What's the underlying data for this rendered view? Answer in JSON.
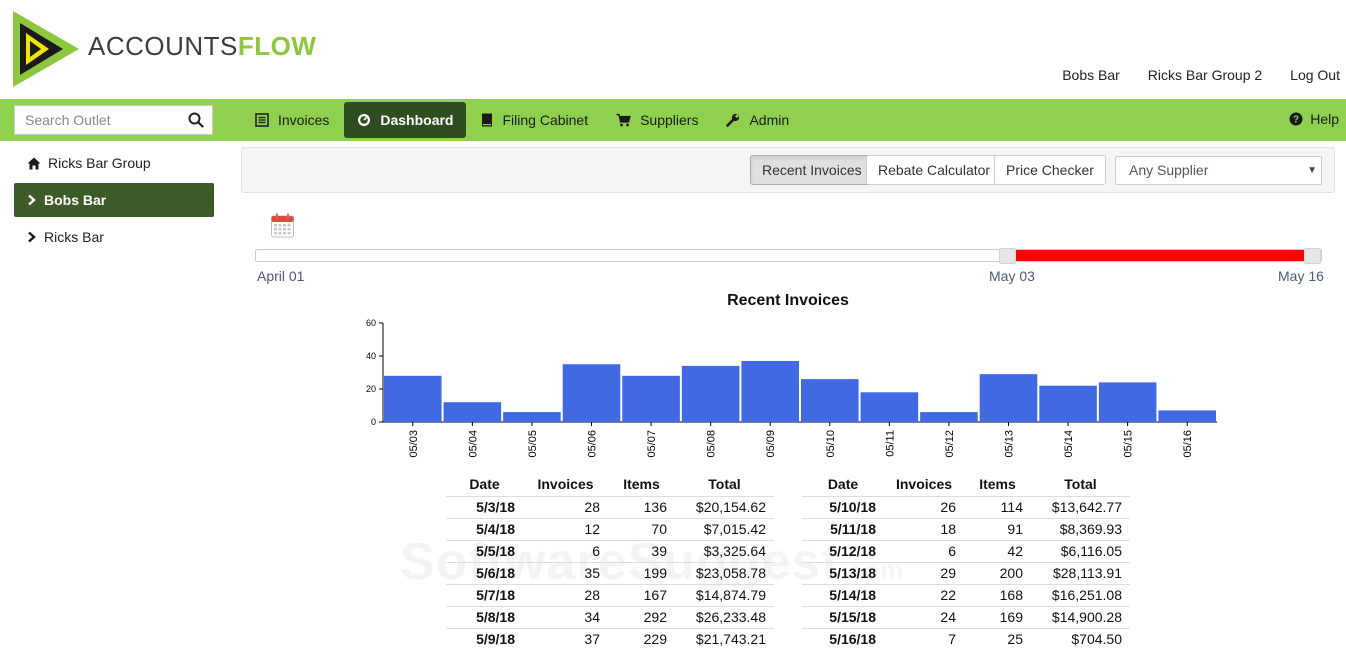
{
  "brand": {
    "name_part1": "ACCOUNTS",
    "name_part2": "FLOW",
    "logo_icon": "play-triangle-logo"
  },
  "top_links": [
    "Bobs Bar",
    "Ricks Bar Group 2",
    "Log Out"
  ],
  "search": {
    "placeholder": "Search Outlet",
    "value": ""
  },
  "nav": [
    {
      "label": "Invoices",
      "icon": "list-icon",
      "active": false
    },
    {
      "label": "Dashboard",
      "icon": "dashboard-icon",
      "active": true
    },
    {
      "label": "Filing Cabinet",
      "icon": "book-icon",
      "active": false
    },
    {
      "label": "Suppliers",
      "icon": "cart-icon",
      "active": false
    },
    {
      "label": "Admin",
      "icon": "wrench-icon",
      "active": false
    }
  ],
  "help": {
    "label": "Help",
    "icon": "question-circle-icon"
  },
  "sidebar": [
    {
      "label": "Ricks Bar Group",
      "icon": "home-icon",
      "active": false
    },
    {
      "label": "Bobs Bar",
      "icon": "chevron-right-icon",
      "active": true
    },
    {
      "label": "Ricks Bar",
      "icon": "chevron-right-icon",
      "active": false
    }
  ],
  "toolbar": {
    "buttons": [
      "Recent Invoices",
      "Rebate Calculator",
      "Price Checker"
    ],
    "active_button": "Recent Invoices",
    "supplier_select": "Any Supplier"
  },
  "slider": {
    "start_label": "April 01",
    "range_start_label": "May 03",
    "end_label": "May 16",
    "range_start_fraction": 0.705,
    "range_end_fraction": 1.0,
    "range_color": "#ff0000"
  },
  "chart_data": {
    "type": "bar",
    "title": "Recent Invoices",
    "categories": [
      "05/03",
      "05/04",
      "05/05",
      "05/06",
      "05/07",
      "05/08",
      "05/09",
      "05/10",
      "05/11",
      "05/12",
      "05/13",
      "05/14",
      "05/15",
      "05/16"
    ],
    "values": [
      28,
      12,
      6,
      35,
      28,
      34,
      37,
      26,
      18,
      6,
      29,
      22,
      24,
      7
    ],
    "yticks": [
      0,
      20,
      40,
      60
    ],
    "ylim": [
      0,
      60
    ],
    "bar_color": "#4169e1",
    "grid": false
  },
  "tables": {
    "headers": [
      "Date",
      "Invoices",
      "Items",
      "Total"
    ],
    "left": [
      [
        "5/3/18",
        "28",
        "136",
        "$20,154.62"
      ],
      [
        "5/4/18",
        "12",
        "70",
        "$7,015.42"
      ],
      [
        "5/5/18",
        "6",
        "39",
        "$3,325.64"
      ],
      [
        "5/6/18",
        "35",
        "199",
        "$23,058.78"
      ],
      [
        "5/7/18",
        "28",
        "167",
        "$14,874.79"
      ],
      [
        "5/8/18",
        "34",
        "292",
        "$26,233.48"
      ],
      [
        "5/9/18",
        "37",
        "229",
        "$21,743.21"
      ]
    ],
    "right": [
      [
        "5/10/18",
        "26",
        "114",
        "$13,642.77"
      ],
      [
        "5/11/18",
        "18",
        "91",
        "$8,369.93"
      ],
      [
        "5/12/18",
        "6",
        "42",
        "$6,116.05"
      ],
      [
        "5/13/18",
        "29",
        "200",
        "$28,113.91"
      ],
      [
        "5/14/18",
        "22",
        "168",
        "$16,251.08"
      ],
      [
        "5/15/18",
        "24",
        "169",
        "$14,900.28"
      ],
      [
        "5/16/18",
        "7",
        "25",
        "$704.50"
      ]
    ]
  },
  "watermark": {
    "text": "SoftwareSuggest",
    "suffix": ".com"
  }
}
